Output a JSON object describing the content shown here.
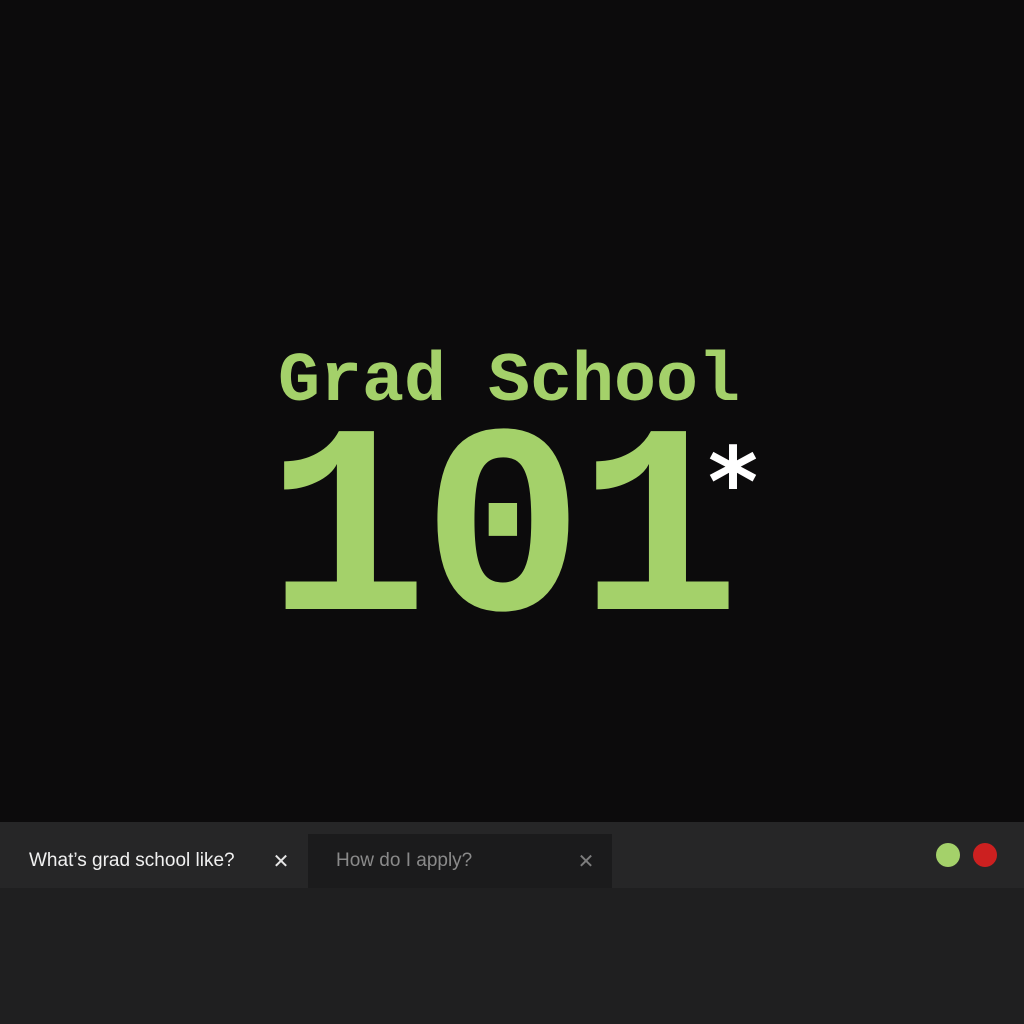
{
  "hero": {
    "subtitle": "Grad School",
    "number": "101",
    "asterisk": "*",
    "accent_color": "#a4d16a",
    "asterisk_color": "#ffffff"
  },
  "tabs": [
    {
      "label": "What’s grad school like?",
      "close_icon": "✕",
      "active": true
    },
    {
      "label": "How do I apply?",
      "close_icon": "✕",
      "active": false
    }
  ],
  "window_controls": {
    "green_color": "#a4d16a",
    "red_color": "#cc2020"
  }
}
